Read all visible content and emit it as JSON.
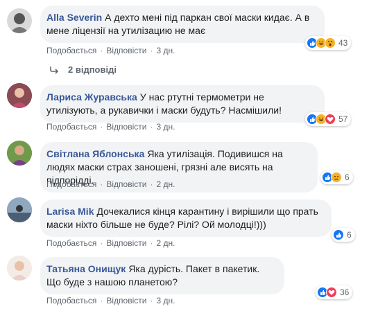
{
  "actions": {
    "like": "Подобається",
    "reply": "Відповісти",
    "dot": "·"
  },
  "replies": {
    "label": "2 відповіді"
  },
  "comments": [
    {
      "author": "Alla Severin",
      "text": "А дехто мені під паркан свої маски кидає. А в мене ліцензії на утилізацию не має",
      "time": "3 дн.",
      "reactions": [
        "like-icon",
        "haha-icon",
        "wow-icon"
      ],
      "reaction_count": "43"
    },
    {
      "author": "Лариса Журавська",
      "text": "У нас ртутні термометри не утилізують, а рукавички і маски будуть? Насмішили!",
      "time": "3 дн.",
      "reactions": [
        "like-icon",
        "haha-icon",
        "love-icon"
      ],
      "reaction_count": "57"
    },
    {
      "author": "Світлана Яблонська",
      "text": "Яка утилізація. Подивишся на людях маски страх заношені, грязні але висять на підпорідді.",
      "time": "2 дн.",
      "reactions": [
        "like-icon",
        "sad-icon"
      ],
      "reaction_count": "6"
    },
    {
      "author": "Larisa Mik",
      "text": "Дочекалися кінця карантину і вирішили що прать маски ніхто більше не буде? Рілі? Ой молодці!)))",
      "time": "2 дн.",
      "reactions": [
        "like-icon"
      ],
      "reaction_count": "6"
    },
    {
      "author": "Татьяна Онищук",
      "text": "Яка дурість. Пакет в пакетик. Що буде з нашою планетою?",
      "time": "3 дн.",
      "reactions": [
        "like-icon",
        "love-icon"
      ],
      "reaction_count": "36"
    }
  ],
  "colors": {
    "author": "#385898",
    "bubble": "#f2f3f5",
    "like": "#1877f2",
    "love": "#f33e58",
    "yellow": "#f7b125"
  }
}
